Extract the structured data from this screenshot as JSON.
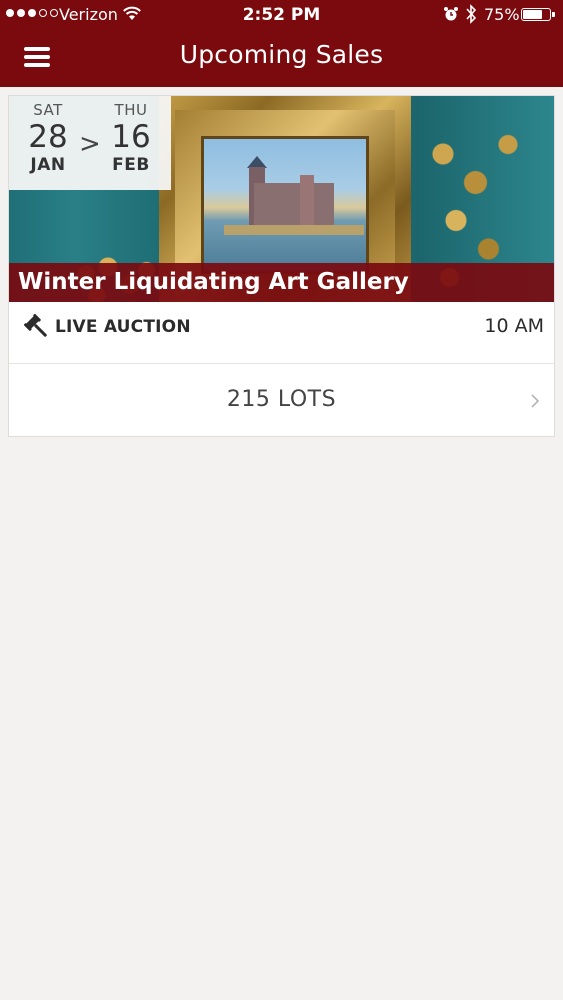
{
  "status_bar": {
    "carrier": "Verizon",
    "time": "2:52 PM",
    "battery_percent": "75%",
    "battery_level": 0.75
  },
  "nav": {
    "title": "Upcoming Sales",
    "menu_icon": "hamburger-menu-icon"
  },
  "sales": [
    {
      "title": "Winter Liquidating Art Gallery",
      "start": {
        "dow": "SAT",
        "day": "28",
        "month": "JAN"
      },
      "separator": ">",
      "end": {
        "dow": "THU",
        "day": "16",
        "month": "FEB"
      },
      "type": "LIVE AUCTION",
      "type_icon": "gavel-icon",
      "time": "10 AM",
      "lots": "215 LOTS"
    }
  ],
  "colors": {
    "brand": "#7b0a0f",
    "background": "#f3f2f0"
  }
}
